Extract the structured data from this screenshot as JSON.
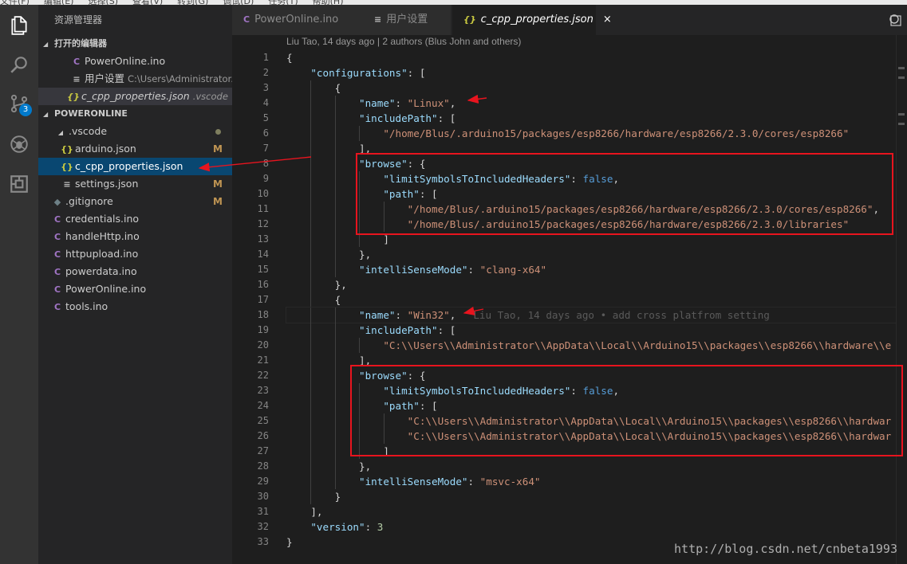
{
  "menubar": {
    "items": [
      "文件(F)",
      "编辑(E)",
      "选择(S)",
      "查看(V)",
      "转到(G)",
      "调试(D)",
      "任务(T)",
      "帮助(H)"
    ]
  },
  "activity_bar": {
    "items": [
      {
        "name": "explorer-icon"
      },
      {
        "name": "search-icon"
      },
      {
        "name": "source-control-icon",
        "badge": "3"
      },
      {
        "name": "debug-icon"
      },
      {
        "name": "extensions-icon"
      }
    ]
  },
  "sidebar": {
    "title": "资源管理器",
    "open_editors_label": "打开的编辑器",
    "open_editors": [
      {
        "icon": "C",
        "icon_type": "ino",
        "label": "PowerOnline.ino",
        "path": ""
      },
      {
        "icon": "≡",
        "icon_type": "settings",
        "label": "用户设置",
        "path": "C:\\Users\\Administrator..."
      },
      {
        "icon": "{}",
        "icon_type": "json",
        "label": "c_cpp_properties.json",
        "path": ".vscode"
      }
    ],
    "project_label": "POWERONLINE",
    "folder": {
      "label": ".vscode",
      "twisty": "◢"
    },
    "files": [
      {
        "icon": "{}",
        "icon_type": "json",
        "label": "arduino.json",
        "status": "M",
        "indent": 2
      },
      {
        "icon": "{}",
        "icon_type": "json",
        "label": "c_cpp_properties.json",
        "status": "",
        "indent": 2
      },
      {
        "icon": "≡",
        "icon_type": "settings",
        "label": "settings.json",
        "status": "M",
        "indent": 2
      },
      {
        "icon": "◆",
        "icon_type": "git",
        "label": ".gitignore",
        "status": "M",
        "indent": 1
      },
      {
        "icon": "C",
        "icon_type": "ino",
        "label": "credentials.ino",
        "status": "",
        "indent": 1
      },
      {
        "icon": "C",
        "icon_type": "ino",
        "label": "handleHttp.ino",
        "status": "",
        "indent": 1
      },
      {
        "icon": "C",
        "icon_type": "ino",
        "label": "httpupload.ino",
        "status": "",
        "indent": 1
      },
      {
        "icon": "C",
        "icon_type": "ino",
        "label": "powerdata.ino",
        "status": "",
        "indent": 1
      },
      {
        "icon": "C",
        "icon_type": "ino",
        "label": "PowerOnline.ino",
        "status": "",
        "indent": 1
      },
      {
        "icon": "C",
        "icon_type": "ino",
        "label": "tools.ino",
        "status": "",
        "indent": 1
      }
    ]
  },
  "tabs": [
    {
      "icon": "C",
      "label": "PowerOnline.ino"
    },
    {
      "icon": "≡",
      "label": "用户设置"
    },
    {
      "icon": "{}",
      "label": "c_cpp_properties.json",
      "close": "×"
    }
  ],
  "editor": {
    "codelens": "Liu Tao, 14 days ago | 2 authors (Blus John and others)",
    "blame": "Liu Tao, 14 days ago • add cross platfrom setting",
    "lines": [
      {
        "indent": 0,
        "parts": [
          [
            "p",
            "{"
          ]
        ]
      },
      {
        "indent": 1,
        "parts": [
          [
            "k",
            "\"configurations\""
          ],
          [
            "p",
            ": ["
          ]
        ]
      },
      {
        "indent": 2,
        "parts": [
          [
            "p",
            "{"
          ]
        ]
      },
      {
        "indent": 3,
        "parts": [
          [
            "k",
            "\"name\""
          ],
          [
            "p",
            ": "
          ],
          [
            "s",
            "\"Linux\""
          ],
          [
            "p",
            ","
          ]
        ]
      },
      {
        "indent": 3,
        "parts": [
          [
            "k",
            "\"includePath\""
          ],
          [
            "p",
            ": ["
          ]
        ]
      },
      {
        "indent": 4,
        "parts": [
          [
            "s",
            "\"/home/Blus/.arduino15/packages/esp8266/hardware/esp8266/2.3.0/cores/esp8266\""
          ]
        ]
      },
      {
        "indent": 3,
        "parts": [
          [
            "p",
            "],"
          ]
        ]
      },
      {
        "indent": 3,
        "parts": [
          [
            "k",
            "\"browse\""
          ],
          [
            "p",
            ": {"
          ]
        ]
      },
      {
        "indent": 4,
        "parts": [
          [
            "k",
            "\"limitSymbolsToIncludedHeaders\""
          ],
          [
            "p",
            ": "
          ],
          [
            "b",
            "false"
          ],
          [
            "p",
            ","
          ]
        ]
      },
      {
        "indent": 4,
        "parts": [
          [
            "k",
            "\"path\""
          ],
          [
            "p",
            ": ["
          ]
        ]
      },
      {
        "indent": 5,
        "parts": [
          [
            "s",
            "\"/home/Blus/.arduino15/packages/esp8266/hardware/esp8266/2.3.0/cores/esp8266\""
          ],
          [
            "p",
            ","
          ]
        ]
      },
      {
        "indent": 5,
        "parts": [
          [
            "s",
            "\"/home/Blus/.arduino15/packages/esp8266/hardware/esp8266/2.3.0/libraries\""
          ]
        ]
      },
      {
        "indent": 4,
        "parts": [
          [
            "p",
            "]"
          ]
        ]
      },
      {
        "indent": 3,
        "parts": [
          [
            "p",
            "},"
          ]
        ]
      },
      {
        "indent": 3,
        "parts": [
          [
            "k",
            "\"intelliSenseMode\""
          ],
          [
            "p",
            ": "
          ],
          [
            "s",
            "\"clang-x64\""
          ]
        ]
      },
      {
        "indent": 2,
        "parts": [
          [
            "p",
            "},"
          ]
        ]
      },
      {
        "indent": 2,
        "parts": [
          [
            "p",
            "{"
          ]
        ]
      },
      {
        "indent": 3,
        "parts": [
          [
            "k",
            "\"name\""
          ],
          [
            "p",
            ": "
          ],
          [
            "s",
            "\"Win32\""
          ],
          [
            "p",
            ","
          ]
        ],
        "blame": true
      },
      {
        "indent": 3,
        "parts": [
          [
            "k",
            "\"includePath\""
          ],
          [
            "p",
            ": ["
          ]
        ]
      },
      {
        "indent": 4,
        "parts": [
          [
            "s",
            "\"C:\\\\Users\\\\Administrator\\\\AppData\\\\Local\\\\Arduino15\\\\packages\\\\esp8266\\\\hardware\\\\e"
          ]
        ]
      },
      {
        "indent": 3,
        "parts": [
          [
            "p",
            "],"
          ]
        ]
      },
      {
        "indent": 3,
        "parts": [
          [
            "k",
            "\"browse\""
          ],
          [
            "p",
            ": {"
          ]
        ]
      },
      {
        "indent": 4,
        "parts": [
          [
            "k",
            "\"limitSymbolsToIncludedHeaders\""
          ],
          [
            "p",
            ": "
          ],
          [
            "b",
            "false"
          ],
          [
            "p",
            ","
          ]
        ]
      },
      {
        "indent": 4,
        "parts": [
          [
            "k",
            "\"path\""
          ],
          [
            "p",
            ": ["
          ]
        ]
      },
      {
        "indent": 5,
        "parts": [
          [
            "s",
            "\"C:\\\\Users\\\\Administrator\\\\AppData\\\\Local\\\\Arduino15\\\\packages\\\\esp8266\\\\hardwar"
          ]
        ]
      },
      {
        "indent": 5,
        "parts": [
          [
            "s",
            "\"C:\\\\Users\\\\Administrator\\\\AppData\\\\Local\\\\Arduino15\\\\packages\\\\esp8266\\\\hardwar"
          ]
        ]
      },
      {
        "indent": 4,
        "parts": [
          [
            "p",
            "]"
          ]
        ]
      },
      {
        "indent": 3,
        "parts": [
          [
            "p",
            "},"
          ]
        ]
      },
      {
        "indent": 3,
        "parts": [
          [
            "k",
            "\"intelliSenseMode\""
          ],
          [
            "p",
            ": "
          ],
          [
            "s",
            "\"msvc-x64\""
          ]
        ]
      },
      {
        "indent": 2,
        "parts": [
          [
            "p",
            "}"
          ]
        ]
      },
      {
        "indent": 1,
        "parts": [
          [
            "p",
            "],"
          ]
        ]
      },
      {
        "indent": 1,
        "parts": [
          [
            "k",
            "\"version\""
          ],
          [
            "p",
            ": "
          ],
          [
            "n",
            "3"
          ]
        ]
      },
      {
        "indent": 0,
        "parts": [
          [
            "p",
            "}"
          ]
        ]
      }
    ]
  },
  "watermark": "http://blog.csdn.net/cnbeta1993",
  "colors": {
    "accent": "#007acc",
    "annotation_red": "#e8141e",
    "modified": "#c09553"
  }
}
